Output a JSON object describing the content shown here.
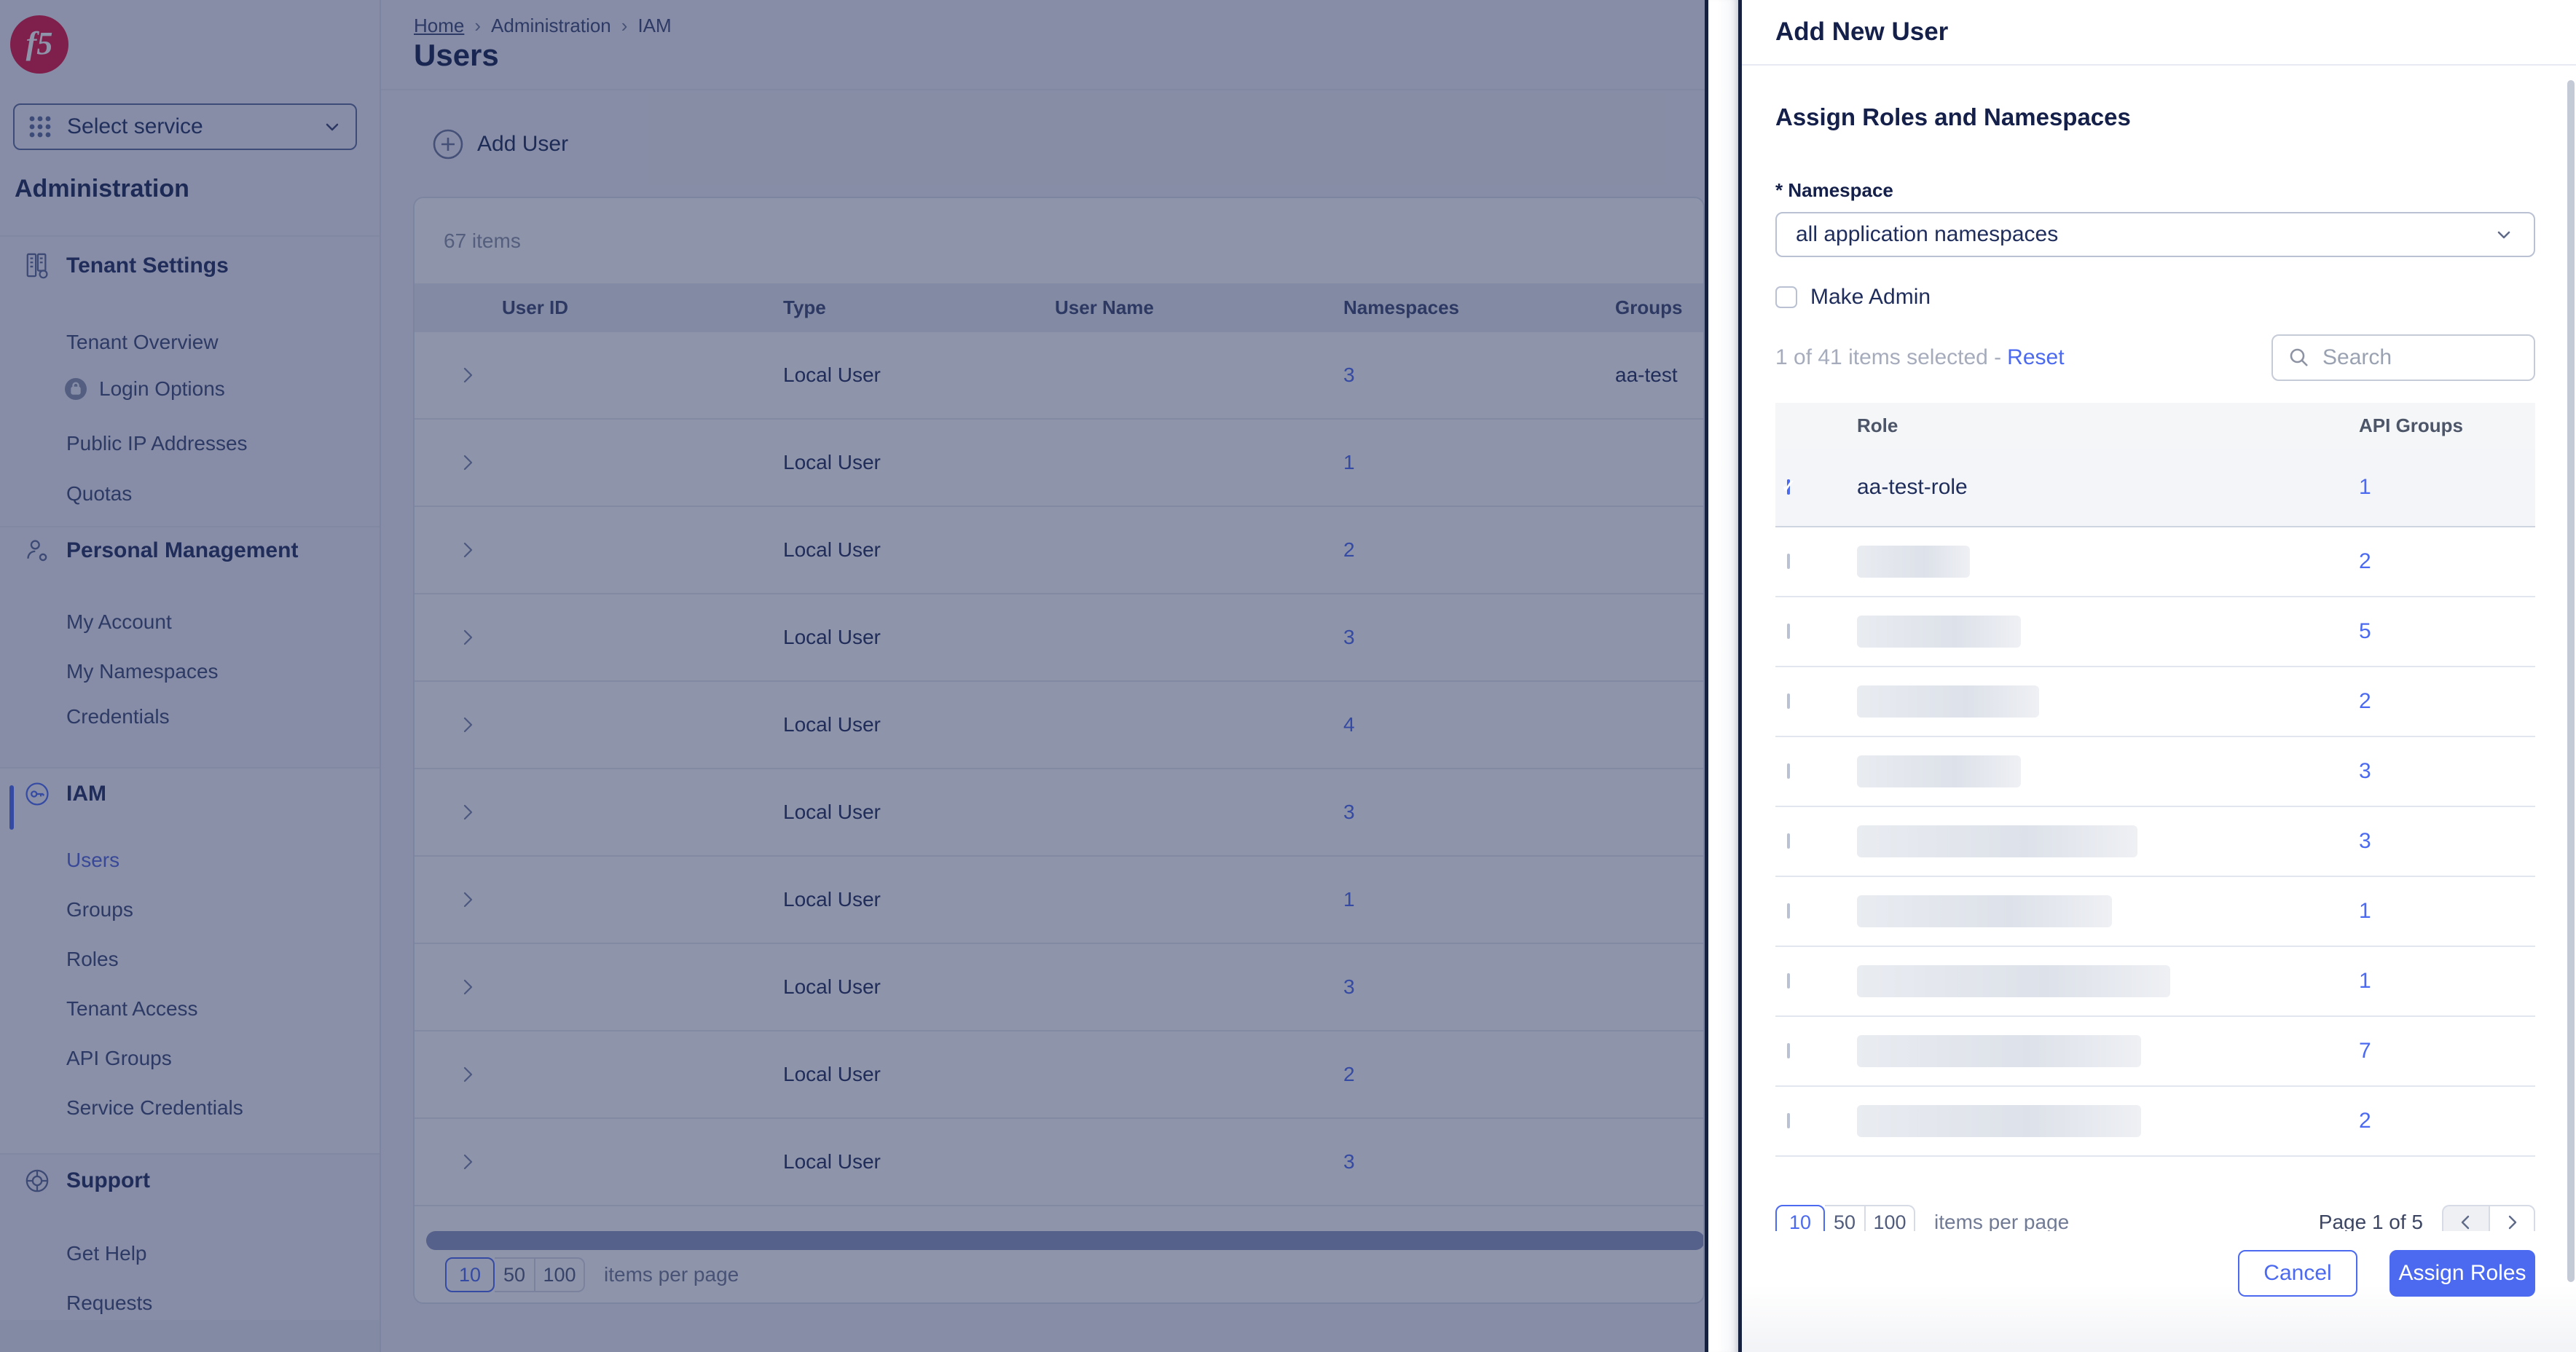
{
  "colors": {
    "accent": "#4c6af0",
    "navy": "#1d2b58",
    "f5red": "#e01441"
  },
  "app": {
    "logo": "f5"
  },
  "sidebar": {
    "select_service": "Select service",
    "heading": "Administration",
    "groups": [
      {
        "label": "Tenant Settings",
        "icon": "building-gear-icon",
        "items": [
          {
            "label": "Tenant Overview"
          },
          {
            "label": "Login Options",
            "icon": "lock-icon"
          },
          {
            "label": "Public IP Addresses"
          },
          {
            "label": "Quotas"
          }
        ]
      },
      {
        "label": "Personal Management",
        "icon": "user-gear-icon",
        "items": [
          {
            "label": "My Account"
          },
          {
            "label": "My Namespaces"
          },
          {
            "label": "Credentials"
          }
        ]
      },
      {
        "label": "IAM",
        "icon": "key-icon",
        "items": [
          {
            "label": "Users",
            "active": true
          },
          {
            "label": "Groups"
          },
          {
            "label": "Roles"
          },
          {
            "label": "Tenant Access"
          },
          {
            "label": "API Groups"
          },
          {
            "label": "Service Credentials"
          }
        ]
      },
      {
        "label": "Support",
        "icon": "lifebuoy-icon",
        "items": [
          {
            "label": "Get Help"
          },
          {
            "label": "Requests"
          }
        ]
      }
    ]
  },
  "main": {
    "breadcrumb": [
      "Home",
      "Administration",
      "IAM"
    ],
    "title": "Users",
    "toolbar": {
      "add_user": "Add User"
    },
    "table": {
      "items_count": "67 items",
      "columns": [
        "User ID",
        "Type",
        "User Name",
        "Namespaces",
        "Groups"
      ],
      "rows": [
        {
          "type": "Local User",
          "namespaces": "3",
          "groups": "aa-test",
          "id_w": 285,
          "name_w": 250
        },
        {
          "type": "Local User",
          "namespaces": "1",
          "id_w": 260,
          "name_w": 150
        },
        {
          "type": "Local User",
          "namespaces": "2",
          "id_w": 175,
          "name_w": 140
        },
        {
          "type": "Local User",
          "namespaces": "3",
          "id_w": 275,
          "name_w": 210
        },
        {
          "type": "Local User",
          "namespaces": "4",
          "id_w": 140,
          "name_w": 130
        },
        {
          "type": "Local User",
          "namespaces": "3",
          "id_w": 135,
          "name_w": 115
        },
        {
          "type": "Local User",
          "namespaces": "1",
          "id_w": 115,
          "name_w": 95
        },
        {
          "type": "Local User",
          "namespaces": "3",
          "id_w": 255,
          "name_w": 185
        },
        {
          "type": "Local User",
          "namespaces": "2",
          "id_w": 150,
          "name_w": 125
        },
        {
          "type": "Local User",
          "namespaces": "3",
          "id_w": 370,
          "name_w": 335,
          "tall": true
        }
      ]
    },
    "pagination": {
      "sizes": [
        "10",
        "50",
        "100"
      ],
      "active_size": "10",
      "label": "items per page"
    }
  },
  "drawer": {
    "title": "Add New User",
    "section_title": "Assign Roles and Namespaces",
    "namespace_label": "* Namespace",
    "namespace_value": "all application namespaces",
    "make_admin_label": "Make Admin",
    "selection_text": "1 of 41 items selected -",
    "reset_label": "Reset",
    "search_placeholder": "Search",
    "table": {
      "columns": [
        "Role",
        "API Groups"
      ],
      "rows": [
        {
          "role": "aa-test-role",
          "api": "1",
          "checked": true
        },
        {
          "api": "2",
          "blur_w": 155
        },
        {
          "api": "5",
          "blur_w": 225
        },
        {
          "api": "2",
          "blur_w": 250
        },
        {
          "api": "3",
          "blur_w": 225
        },
        {
          "api": "3",
          "blur_w": 385
        },
        {
          "api": "1",
          "blur_w": 350
        },
        {
          "api": "1",
          "blur_w": 430
        },
        {
          "api": "7",
          "blur_w": 390
        },
        {
          "api": "2",
          "blur_w": 390
        }
      ]
    },
    "pagination": {
      "sizes": [
        "10",
        "50",
        "100"
      ],
      "active_size": "10",
      "label": "items per page",
      "page_label": "Page 1 of 5"
    },
    "cancel_label": "Cancel",
    "assign_label": "Assign Roles"
  }
}
